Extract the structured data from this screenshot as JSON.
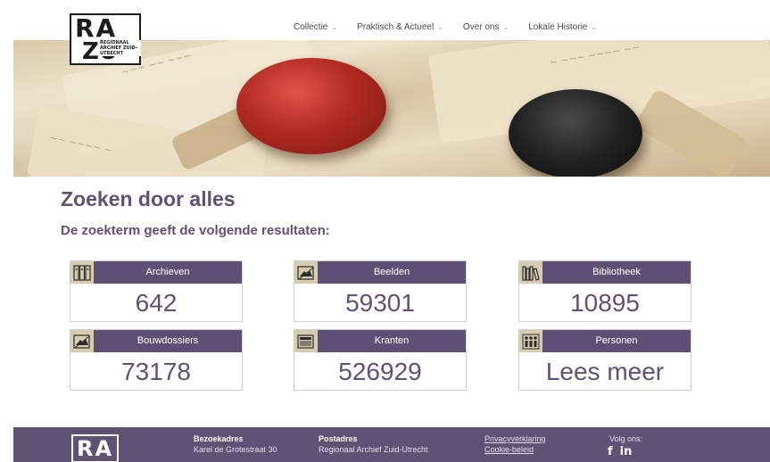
{
  "logo": {
    "letters_top": "RA",
    "letters_bottom": "ZU",
    "tagline": "REGIONAAL ARCHIEF ZUID-UTRECHT"
  },
  "nav": {
    "items": [
      {
        "label": "Collectie",
        "icon": "chevron-down-icon"
      },
      {
        "label": "Praktisch & Actueel",
        "icon": "chevron-down-icon"
      },
      {
        "label": "Over ons",
        "icon": "chevron-down-icon"
      },
      {
        "label": "Lokale Historie",
        "icon": "chevron-down-icon"
      }
    ]
  },
  "page": {
    "title": "Zoeken door alles",
    "subtitle": "De zoekterm geeft de volgende resultaten:"
  },
  "cards": [
    {
      "label": "Archieven",
      "value": "642",
      "icon": "archive-boxes-icon"
    },
    {
      "label": "Beelden",
      "value": "59301",
      "icon": "image-icon"
    },
    {
      "label": "Bibliotheek",
      "value": "10895",
      "icon": "books-icon"
    },
    {
      "label": "Bouwdossiers",
      "value": "73178",
      "icon": "building-plan-icon"
    },
    {
      "label": "Kranten",
      "value": "526929",
      "icon": "newspaper-icon"
    },
    {
      "label": "Personen",
      "value": "Lees meer",
      "icon": "people-icon"
    }
  ],
  "footer": {
    "logo_text": "RA",
    "visit": {
      "title": "Bezoekadres",
      "line1": "Karel de Grotestraat 30"
    },
    "post": {
      "title": "Postadres",
      "line1": "Regionaal Archief Zuid-Utrecht"
    },
    "links": [
      "Privacyverklaring",
      "Cookie-beleid"
    ],
    "follow_label": "Volg ons:",
    "social": [
      "facebook-icon",
      "linkedin-icon"
    ]
  },
  "colors": {
    "brand_purple": "#5e5075",
    "icon_bg": "#d8ccb0"
  }
}
